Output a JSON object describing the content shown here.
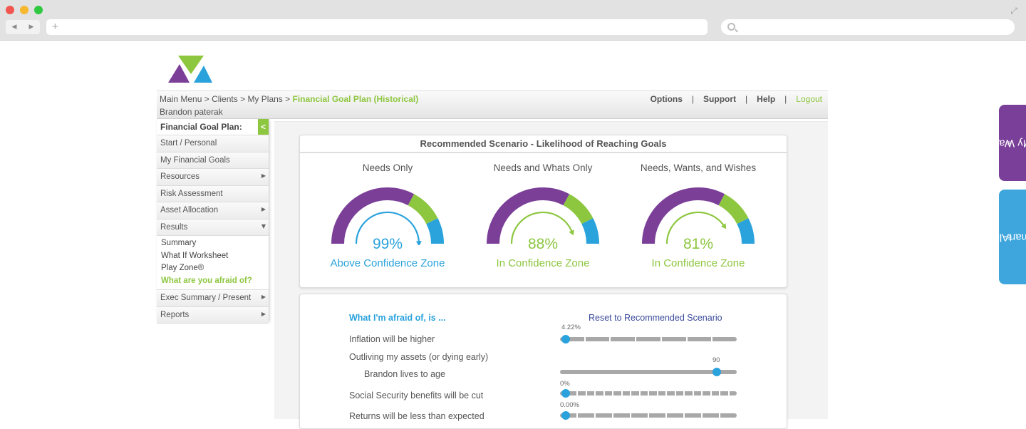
{
  "browser": {
    "nav_back": "◀",
    "nav_forward": "▶",
    "new_tab": "+"
  },
  "colors": {
    "brand_green": "#8dc63f",
    "brand_blue": "#2aa2dc",
    "brand_purple": "#7b3f98",
    "link_navy": "#3b4a9a"
  },
  "header": {
    "breadcrumb": {
      "items": [
        "Main Menu",
        "Clients",
        "My Plans"
      ],
      "separator": " > ",
      "current": "Financial Goal Plan (Historical)"
    },
    "client_name": "Brandon paterak",
    "nav": {
      "options": "Options",
      "support": "Support",
      "help": "Help",
      "logout": "Logout",
      "separator": "|"
    }
  },
  "sidebar": {
    "title": "Financial Goal Plan:",
    "collapse_icon": "<",
    "items": [
      {
        "label": "Start / Personal"
      },
      {
        "label": "My Financial Goals"
      },
      {
        "label": "Resources",
        "arrow": "▶"
      },
      {
        "label": "Risk Assessment"
      },
      {
        "label": "Asset Allocation",
        "arrow": "▶"
      },
      {
        "label": "Results",
        "arrow": "▼"
      }
    ],
    "results_sub": [
      {
        "label": "Summary"
      },
      {
        "label": "What If Worksheet"
      },
      {
        "label": "Play Zone®"
      },
      {
        "label": "What are you afraid of?"
      }
    ],
    "items_after": [
      {
        "label": "Exec Summary / Present",
        "arrow": "▶"
      },
      {
        "label": "Reports",
        "arrow": "▶"
      }
    ]
  },
  "scenario_panel": {
    "title": "Recommended Scenario - Likelihood of Reaching Goals",
    "gauges": [
      {
        "title": "Needs Only",
        "value": "99%",
        "level": 0.99,
        "zone": "Above Confidence Zone"
      },
      {
        "title": "Needs and Whats Only",
        "value": "88%",
        "level": 0.88,
        "zone": "In Confidence Zone"
      },
      {
        "title": "Needs, Wants, and Wishes",
        "value": "81%",
        "level": 0.81,
        "zone": "In Confidence Zone"
      }
    ]
  },
  "afraid_panel": {
    "heading": "What I'm afraid of, is ...",
    "reset_link": "Reset to Recommended Scenario",
    "questions": [
      {
        "label": "Inflation will be higher"
      },
      {
        "label": "Outliving my assets (or dying early)"
      },
      {
        "label": "Brandon lives to age"
      },
      {
        "label": "Social Security benefits will be cut"
      },
      {
        "label": "Returns will be less than expected"
      }
    ],
    "sliders": [
      {
        "value_label": "4.22%",
        "level": 0.0
      },
      {
        "value_label": "90",
        "level": 0.9
      },
      {
        "value_label": "0%",
        "level": 0.0
      },
      {
        "value_label": "0.00%",
        "level": 0.0
      }
    ]
  },
  "side_tabs": {
    "my_way": "My Way",
    "smart_alex": "SmartAlex",
    "trademark": "®"
  }
}
